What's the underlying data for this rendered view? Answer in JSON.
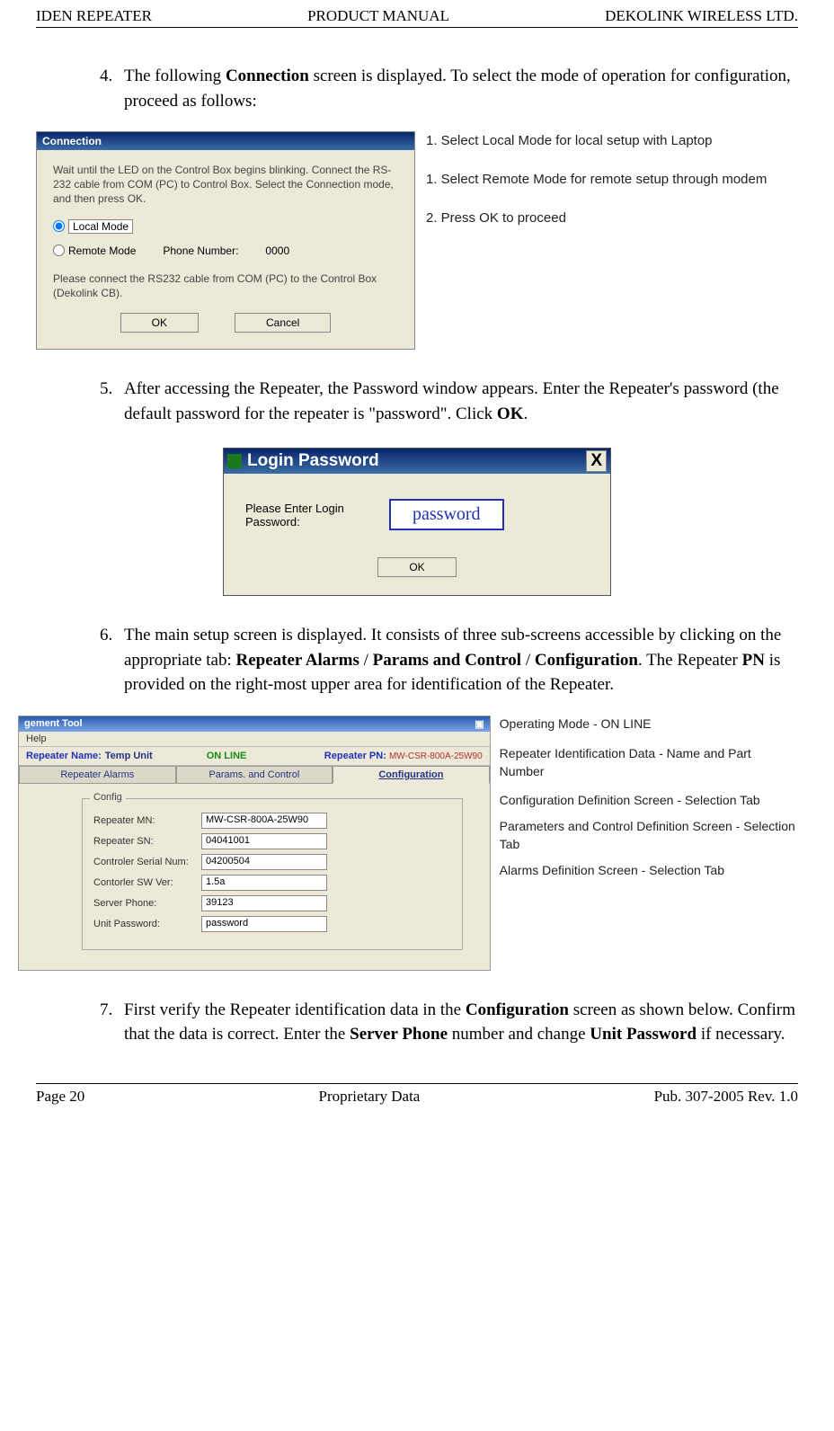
{
  "header": {
    "left": "IDEN REPEATER",
    "center": "PRODUCT MANUAL",
    "right": "DEKOLINK WIRELESS LTD."
  },
  "footer": {
    "left": "Page 20",
    "center": "Proprietary Data",
    "right": "Pub. 307-2005 Rev. 1.0"
  },
  "steps": {
    "s4_a": "The following ",
    "s4_b": "Connection",
    "s4_c": " screen is displayed. To select the mode of operation for configuration, proceed as follows:",
    "s5_a": "After accessing the Repeater, the Password window appears. Enter the Repeater's password (the default password for the repeater is \"password\". Click ",
    "s5_b": "OK",
    "s5_c": ".",
    "s6_a": "The main setup screen is displayed. It consists of three sub-screens accessible by clicking on the appropriate tab: ",
    "s6_b": "Repeater Alarms",
    "s6_c": " / ",
    "s6_d": "Params and Control",
    "s6_e": " / ",
    "s6_f": "Configuration",
    "s6_g": ".  The Repeater ",
    "s6_h": "PN",
    "s6_i": " is provided on the right-most upper area for identification of the Repeater.",
    "s7_a": "First verify the Repeater identification data in the ",
    "s7_b": "Configuration",
    "s7_c": " screen as shown below.  Confirm that the data is correct.  Enter the ",
    "s7_d": "Server Phone",
    "s7_e": " number and change ",
    "s7_f": "Unit Password",
    "s7_g": " if necessary."
  },
  "fig1": {
    "title": "Connection",
    "instr": "Wait until the LED on the Control Box begins blinking. Connect the RS-232 cable from COM (PC) to Control Box. Select the Connection mode, and then press OK.",
    "opt1": "Local Mode",
    "opt2": "Remote Mode",
    "phonelbl": "Phone Number:",
    "phoneval": "0000",
    "note": "Please connect the RS232 cable from COM (PC) to the Control Box (Dekolink CB).",
    "ok": "OK",
    "cancel": "Cancel",
    "call1": "1. Select Local Mode for local setup with Laptop",
    "call2": "1. Select Remote Mode for remote setup through modem",
    "call3": "2. Press OK to proceed"
  },
  "fig2": {
    "title": "Login Password",
    "prompt": "Please Enter Login Password:",
    "value": "password",
    "ok": "OK",
    "close": "X"
  },
  "fig3": {
    "apptitle": "gement Tool",
    "help": "Help",
    "namelbl": "Repeater Name:",
    "nameval": "Temp Unit",
    "online": "ON LINE",
    "pnlbl": "Repeater PN:",
    "pnval": "MW-CSR-800A-25W90",
    "tab1": "Repeater Alarms",
    "tab2": "Params. and Control",
    "tab3": "Configuration",
    "group": "Config",
    "f1": "Repeater MN:",
    "v1": "MW-CSR-800A-25W90",
    "f2": "Repeater SN:",
    "v2": "04041001",
    "f3": "Controler Serial Num:",
    "v3": "04200504",
    "f4": "Contorler  SW Ver:",
    "v4": "1.5a",
    "f5": "Server Phone:",
    "v5": "39123",
    "f6": "Unit Password:",
    "v6": "password",
    "call1": "Operating Mode - ON LINE",
    "call2": "Repeater Identification Data - Name and Part Number",
    "call3": "Configuration Definition Screen - Selection Tab",
    "call4": "Parameters and Control Definition Screen - Selection Tab",
    "call5": "Alarms Definition Screen - Selection Tab"
  }
}
